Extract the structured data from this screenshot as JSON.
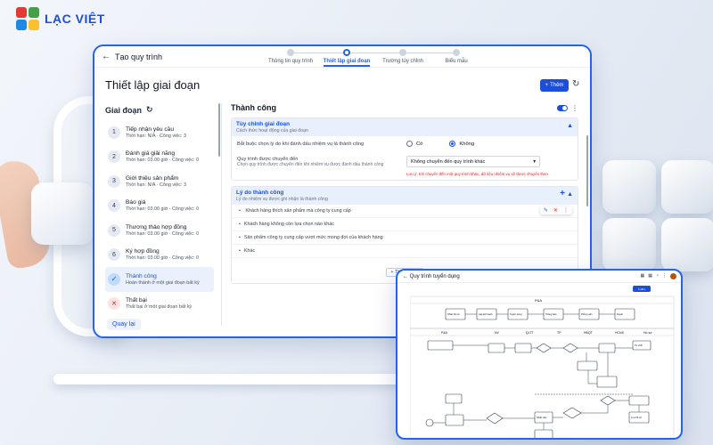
{
  "brand": {
    "name": "LẠC VIỆT",
    "colors": [
      "#e53935",
      "#43a047",
      "#1e88e5",
      "#fbc02d"
    ]
  },
  "window": {
    "back_label": "Tạo quy trình",
    "steps": [
      {
        "label": "Thông tin quy trình",
        "active": false
      },
      {
        "label": "Thiết lập giai đoạn",
        "active": true
      },
      {
        "label": "Trường tùy chỉnh",
        "active": false
      },
      {
        "label": "Biểu mẫu",
        "active": false
      }
    ],
    "page_title": "Thiết lập giai đoạn",
    "add_button": "Thêm",
    "back_button": "Quay lại"
  },
  "stages": {
    "heading": "Giai đoạn",
    "items": [
      {
        "num": "1",
        "title": "Tiếp nhận yêu cầu",
        "meta": "Thời hạn: N/A · Công việc: 3"
      },
      {
        "num": "2",
        "title": "Đánh giá giải năng",
        "meta": "Thời hạn: 03.00 giờ · Công việc: 0"
      },
      {
        "num": "3",
        "title": "Giới thiệu sản phẩm",
        "meta": "Thời hạn: N/A · Công việc: 3"
      },
      {
        "num": "4",
        "title": "Báo giá",
        "meta": "Thời hạn: 03.00 giờ · Công việc: 0"
      },
      {
        "num": "5",
        "title": "Thương thảo hợp đồng",
        "meta": "Thời hạn: 03.00 giờ · Công việc: 0"
      },
      {
        "num": "6",
        "title": "Ký hợp đồng",
        "meta": "Thời hạn: 03.00 giờ · Công việc: 0"
      },
      {
        "num": "✓",
        "title": "Thành công",
        "meta": "Hoàn thành ở một giai đoạn bất kỳ"
      },
      {
        "num": "✕",
        "title": "Thất bại",
        "meta": "Thất bại ở một giai đoạn bất kỳ"
      }
    ]
  },
  "detail": {
    "title": "Thành công",
    "custom": {
      "title": "Tùy chỉnh giai đoạn",
      "subtitle": "Cách thức hoạt động của giai đoạn",
      "q1": "Bắt buộc chọn lý do khi đánh dấu nhiệm vụ là thành công",
      "opt_yes": "Có",
      "opt_no": "Không",
      "q2": "Quy trình được chuyển đến",
      "q2_sub": "Chọn quy trình được chuyển đến khi nhiệm vụ được đánh dấu thành công",
      "select_value": "Không chuyển đến quy trình khác",
      "hint": "Lưu ý: Khi chuyển đến một quy trình khác, dữ liệu nhiệm vụ sẽ được chuyển theo"
    },
    "reasons": {
      "title": "Lý do thành công",
      "subtitle": "Lý do nhiệm vụ được ghi nhận là thành công",
      "items": [
        "Khách hàng thích sản phẩm mà công ty cung cấp",
        "Khách hàng không còn lựa chọn nào khác",
        "Sản phẩm công ty cung cấp vượt mức mong đợi của khách hàng",
        "Khác"
      ],
      "add_label": "+ Thêm lý do"
    }
  },
  "workflow": {
    "title": "Quy trình tuyển dụng",
    "save_label": "Lưu",
    "lane_top": "P&A",
    "lane_headers": [
      "P&A",
      "NV",
      "QLTT",
      "TP",
      "HĐQT",
      "HCNS",
      "Hồ sơ"
    ],
    "nodes": [
      "Nhận hồ sơ",
      "Lập kế hoạch",
      "Tuyển dụng",
      "Thông báo",
      "Phỏng vấn",
      "Duyệt",
      "Từ chối",
      "Nhận việc",
      "Lưu hồ sơ"
    ]
  }
}
